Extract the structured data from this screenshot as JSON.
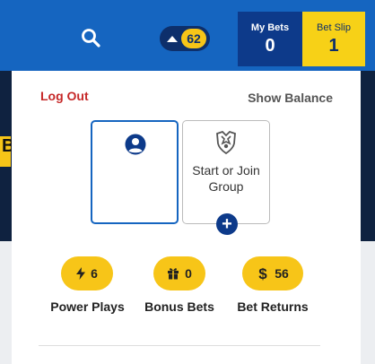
{
  "topbar": {
    "search_icon": "search-icon",
    "notification_count": "62",
    "my_bets": {
      "label": "My Bets",
      "count": "0"
    },
    "bet_slip": {
      "label": "Bet Slip",
      "count": "1"
    }
  },
  "background": {
    "partial_text": "B"
  },
  "panel": {
    "logout_label": "Log Out",
    "show_balance_label": "Show Balance",
    "profile_card": {
      "icon": "user-circle-icon"
    },
    "group_card": {
      "icon": "group-emblem-icon",
      "label": "Start or Join Group",
      "add_icon": "plus-icon"
    },
    "stats": [
      {
        "icon": "lightning-icon",
        "value": "6",
        "label": "Power Plays"
      },
      {
        "icon": "gift-icon",
        "value": "0",
        "label": "Bonus Bets"
      },
      {
        "icon": "dollar-icon",
        "value": "56",
        "label": "Bet Returns"
      }
    ]
  },
  "colors": {
    "topbar": "#1565c0",
    "accent_yellow": "#f7c518",
    "navy": "#0d2f6b",
    "logout_red": "#c62828"
  }
}
